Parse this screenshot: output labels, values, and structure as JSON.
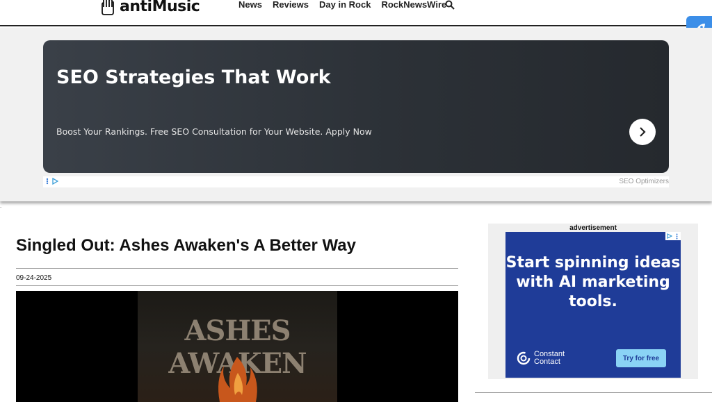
{
  "header": {
    "logo_text": "antiMusic",
    "nav": [
      "News",
      "Reviews",
      "Day in Rock",
      "RockNewsWire"
    ],
    "search_icon": "search-icon"
  },
  "floating_button": {
    "icon": "rocket-icon",
    "color": "#3b8ee8"
  },
  "top_ad": {
    "title": "SEO Strategies That Work",
    "description": "Boost Your Rankings. Free SEO Consultation for Your Website. Apply Now",
    "advertiser": "SEO Optimizers",
    "arrow_icon": "chevron-right-icon"
  },
  "article": {
    "headline": "Singled Out: Ashes Awaken's A Better Way",
    "date": "09-24-2025",
    "image_text": "ASHES AWAKEN"
  },
  "sidebar_ad": {
    "label": "advertisement",
    "headline": "Start spinning ideas with AI marketing tools.",
    "brand_line1": "Constant",
    "brand_line2": "Contact",
    "cta": "Try for free",
    "bg_color": "#1f3c98",
    "cta_color": "#8ad3f5"
  }
}
